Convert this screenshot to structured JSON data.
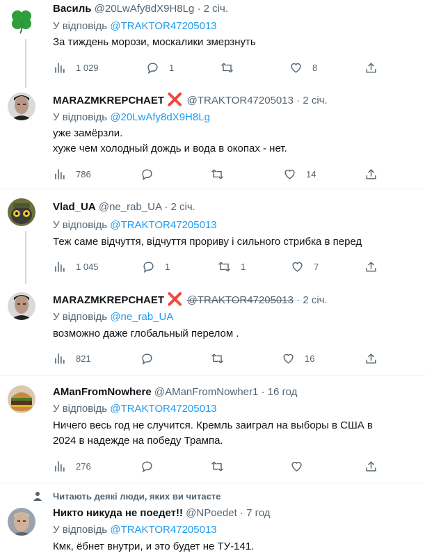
{
  "tweets": [
    {
      "name": "Василь",
      "handle": "@20LwAfy8dX9H8Lg",
      "sep": "·",
      "time": "2 січ.",
      "reply_prefix": "У відповідь",
      "reply_to": "@TRAKTOR47205013",
      "lines": [
        "За тиждень морози, москалики змерзнуть"
      ],
      "stats": {
        "views": "1 029",
        "replies": "1",
        "retweets": "",
        "likes": "8"
      }
    },
    {
      "name": "MARAZMKREPCHAET",
      "badge": "❌",
      "handle": "@TRAKTOR47205013",
      "sep": "·",
      "time": "2 січ.",
      "reply_prefix": "У відповідь",
      "reply_to": "@20LwAfy8dX9H8Lg",
      "lines": [
        "уже замёрзли.",
        "хуже чем холодный дождь и вода в окопах - нет."
      ],
      "stats": {
        "views": "786",
        "replies": "",
        "retweets": "",
        "likes": "14"
      }
    },
    {
      "name": "Vlad_UA",
      "handle": "@ne_rab_UA",
      "sep": "·",
      "time": "2 січ.",
      "reply_prefix": "У відповідь",
      "reply_to": "@TRAKTOR47205013",
      "lines": [
        "Теж саме відчуття, відчуття прориву і сильного стрибка в перед"
      ],
      "stats": {
        "views": "1 045",
        "replies": "1",
        "retweets": "1",
        "likes": "7"
      }
    },
    {
      "name": "MARAZMKREPCHAET",
      "badge": "❌",
      "handle": "@TRAKTOR47205013",
      "sep": "·",
      "time": "2 січ.",
      "reply_prefix": "У відповідь",
      "reply_to": "@ne_rab_UA",
      "lines": [
        "возможно  даже  глобальный перелом ."
      ],
      "stats": {
        "views": "821",
        "replies": "",
        "retweets": "",
        "likes": "16"
      }
    },
    {
      "name": "AManFromNowhere",
      "handle": "@AManFromNowher1",
      "sep": "·",
      "time": "16 год",
      "reply_prefix": "У відповідь",
      "reply_to": "@TRAKTOR47205013",
      "lines": [
        "Ничего весь год не случится. Кремль заиграл на выборы в США в",
        "2024 в надежде на победу Трампа."
      ],
      "stats": {
        "views": "276",
        "replies": "",
        "retweets": "",
        "likes": ""
      }
    },
    {
      "social_context": "Читають деякі люди, яких ви читаєте",
      "name": "Никто никуда не поедет!!",
      "handle": "@NPoedet",
      "sep": "·",
      "time": "7 год",
      "reply_prefix": "У відповідь",
      "reply_to": "@TRAKTOR47205013",
      "lines": [
        "Кмк, ёбнет внутри, и это будет не ТУ-141."
      ]
    }
  ],
  "colors": {
    "link": "#1d9bf0",
    "muted": "#536471",
    "text": "#0f1419",
    "badge": "#e0245e"
  }
}
